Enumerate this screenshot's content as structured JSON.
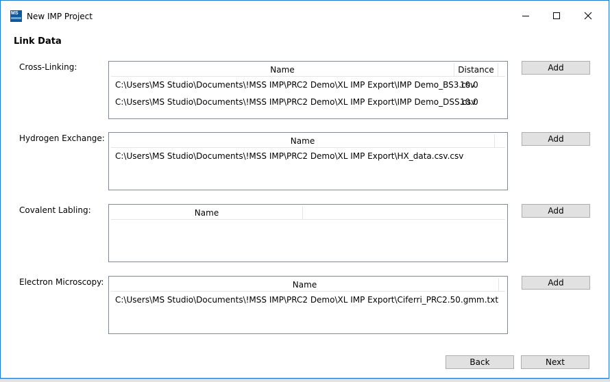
{
  "window": {
    "title": "New IMP Project",
    "logo_text": "MS",
    "controls": {
      "minimize": "minimize-icon",
      "maximize": "maximize-icon",
      "close": "close-icon"
    }
  },
  "page": {
    "title": "Link Data"
  },
  "sections": {
    "cross_linking": {
      "label": "Cross-Linking:",
      "columns": [
        "Name",
        "Distance"
      ],
      "rows": [
        {
          "name": "C:\\Users\\MS Studio\\Documents\\!MSS IMP\\PRC2 Demo\\XL IMP Export\\IMP Demo_BS3.csv",
          "distance": "10.0"
        },
        {
          "name": "C:\\Users\\MS Studio\\Documents\\!MSS IMP\\PRC2 Demo\\XL IMP Export\\IMP Demo_DSS.csv",
          "distance": "10.0"
        }
      ],
      "add_label": "Add"
    },
    "hydrogen_exchange": {
      "label": "Hydrogen Exchange:",
      "columns": [
        "Name"
      ],
      "rows": [
        {
          "name": "C:\\Users\\MS Studio\\Documents\\!MSS IMP\\PRC2 Demo\\XL IMP Export\\HX_data.csv.csv"
        }
      ],
      "add_label": "Add"
    },
    "covalent_labeling": {
      "label": "Covalent Labling:",
      "columns": [
        "Name"
      ],
      "rows": [],
      "add_label": "Add"
    },
    "electron_microscopy": {
      "label": "Electron Microscopy:",
      "columns": [
        "Name"
      ],
      "rows": [
        {
          "name": "C:\\Users\\MS Studio\\Documents\\!MSS IMP\\PRC2 Demo\\XL IMP Export\\Ciferri_PRC2.50.gmm.txt"
        }
      ],
      "add_label": "Add"
    }
  },
  "footer": {
    "back_label": "Back",
    "next_label": "Next"
  }
}
